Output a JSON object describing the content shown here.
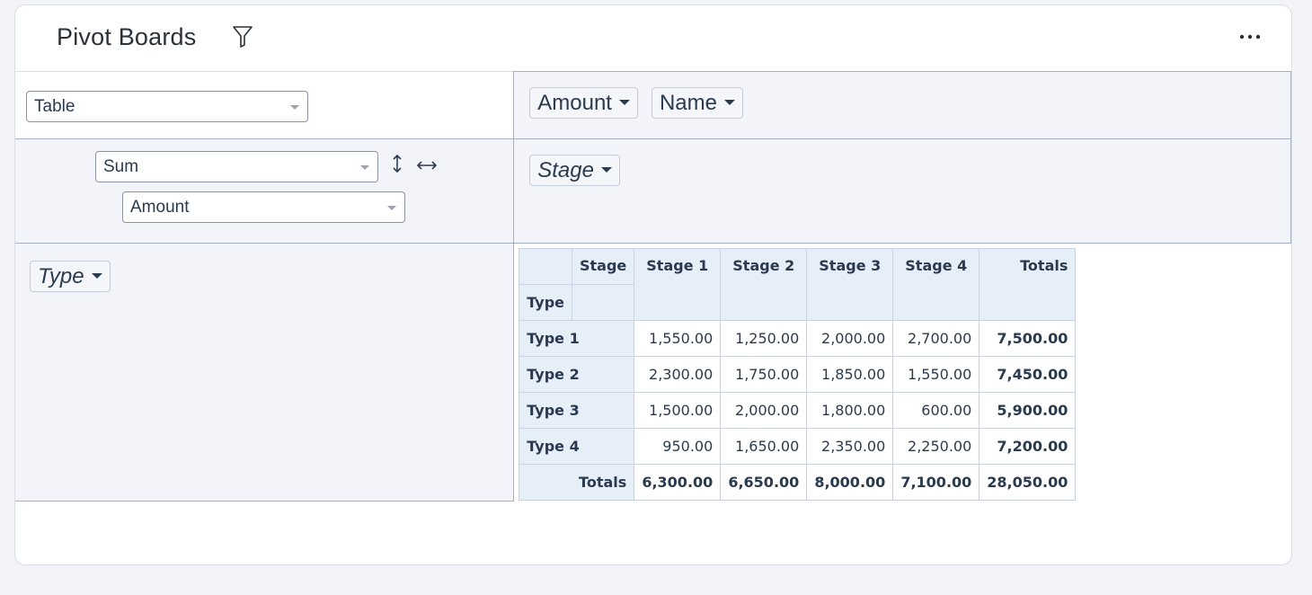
{
  "header": {
    "title": "Pivot Boards",
    "filter_icon": "filter-icon",
    "more_icon": "more-icon"
  },
  "controls": {
    "renderer": "Table",
    "aggregator": "Sum",
    "aggregator_attribute": "Amount",
    "unused_attributes": [
      "Amount",
      "Name"
    ],
    "column_attributes": [
      "Stage"
    ],
    "row_attributes": [
      "Type"
    ],
    "sort_icon": "sort-vertical-icon",
    "arrow_icon": "horizontal-arrow-icon"
  },
  "table": {
    "col_axis_label": "Stage",
    "row_axis_label": "Type",
    "columns": [
      "Stage 1",
      "Stage 2",
      "Stage 3",
      "Stage 4"
    ],
    "totals_label": "Totals",
    "rows": [
      {
        "label": "Type 1",
        "values": [
          "1,550.00",
          "1,250.00",
          "2,000.00",
          "2,700.00"
        ],
        "total": "7,500.00"
      },
      {
        "label": "Type 2",
        "values": [
          "2,300.00",
          "1,750.00",
          "1,850.00",
          "1,550.00"
        ],
        "total": "7,450.00"
      },
      {
        "label": "Type 3",
        "values": [
          "1,500.00",
          "2,000.00",
          "1,800.00",
          "600.00"
        ],
        "total": "5,900.00"
      },
      {
        "label": "Type 4",
        "values": [
          "950.00",
          "1,650.00",
          "2,350.00",
          "2,250.00"
        ],
        "total": "7,200.00"
      }
    ],
    "column_totals": [
      "6,300.00",
      "6,650.00",
      "8,000.00",
      "7,100.00"
    ],
    "grand_total": "28,050.00"
  }
}
